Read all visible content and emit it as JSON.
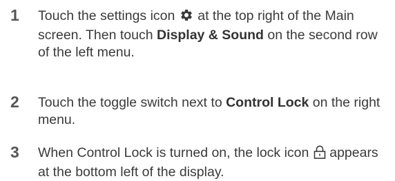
{
  "steps": [
    {
      "number": "1",
      "text_a": "Touch the settings icon",
      "text_b": "at the top right of the Main screen. Then touch",
      "bold_1": "Display & Sound",
      "text_c": "on the second row of the left menu.",
      "icon": "gear-icon"
    },
    {
      "number": "2",
      "text_a": "Touch the toggle switch next to",
      "bold_1": "Control Lock",
      "text_b": "on the right menu."
    },
    {
      "number": "3",
      "text_a": "When Control Lock is turned on, the lock icon",
      "text_b": "appears at the bottom left of the display.",
      "icon": "lock-icon"
    }
  ]
}
